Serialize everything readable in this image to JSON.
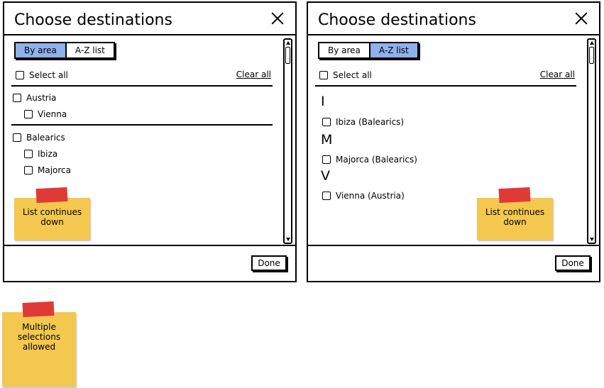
{
  "left_dialog": {
    "title": "Choose destinations",
    "tabs": [
      "By area",
      "A-Z list"
    ],
    "select_all": "Select all",
    "clear_all": "Clear all",
    "groups": [
      {
        "label": "Austria",
        "items": [
          "Vienna"
        ]
      },
      {
        "label": "Balearics",
        "items": [
          "Ibiza",
          "Majorca"
        ]
      }
    ],
    "done": "Done"
  },
  "right_dialog": {
    "title": "Choose destinations",
    "tabs": [
      "By area",
      "A-Z list"
    ],
    "select_all": "Select all",
    "clear_all": "Clear all",
    "sections": [
      {
        "letter": "I",
        "items": [
          "Ibiza (Balearics)"
        ]
      },
      {
        "letter": "M",
        "items": [
          "Majorca (Balearics)"
        ]
      },
      {
        "letter": "V",
        "items": [
          "Vienna (Austria)"
        ]
      }
    ],
    "done": "Done"
  },
  "notes": {
    "list_continues_left": [
      "List continues",
      "down"
    ],
    "list_continues_right": [
      "List continues",
      "down"
    ],
    "multiple": [
      "Multiple",
      "selections",
      "allowed"
    ]
  },
  "colors": {
    "active_tab": "#8fb1ec",
    "sticky_note": "#f4c84f",
    "tape": "#e03a36"
  }
}
